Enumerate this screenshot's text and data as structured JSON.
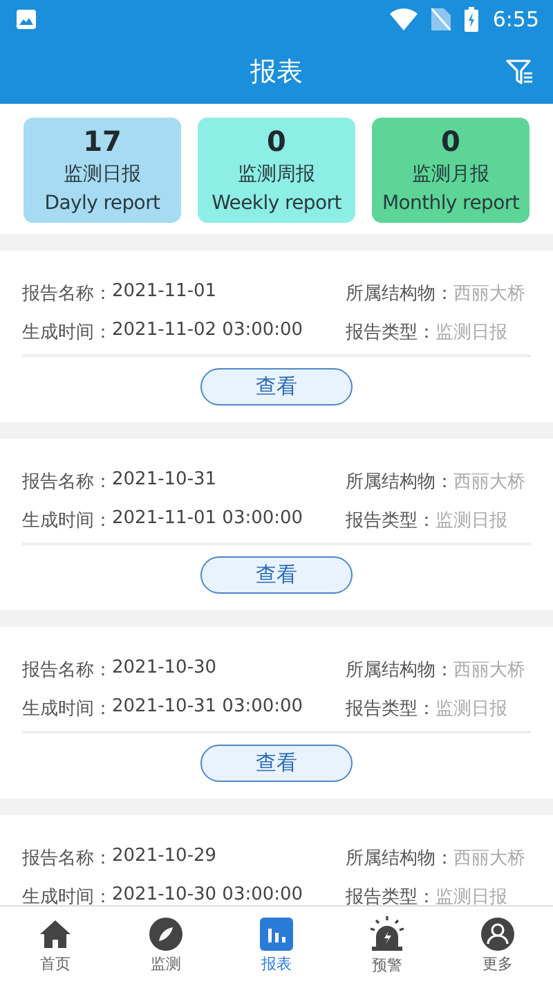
{
  "status_bar": {
    "time": "6:55"
  },
  "header": {
    "title": "报表"
  },
  "summary": [
    {
      "count": "17",
      "label": "监测日报",
      "sublabel": "Dayly report",
      "color": "#a6dbf1"
    },
    {
      "count": "0",
      "label": "监测周报",
      "sublabel": "Weekly report",
      "color": "#8deee5"
    },
    {
      "count": "0",
      "label": "监测月报",
      "sublabel": "Monthly report",
      "color": "#5cd596"
    }
  ],
  "reports": [
    {
      "name_label": "报告名称：",
      "name": "2021-11-01",
      "structure_label": "所属结构物：",
      "structure": "西丽大桥",
      "time_label": "生成时间：",
      "time": "2021-11-02 03:00:00",
      "type_label": "报告类型：",
      "type": "监测日报",
      "button": "查看"
    },
    {
      "name_label": "报告名称：",
      "name": "2021-10-31",
      "structure_label": "所属结构物：",
      "structure": "西丽大桥",
      "time_label": "生成时间：",
      "time": "2021-11-01 03:00:00",
      "type_label": "报告类型：",
      "type": "监测日报",
      "button": "查看"
    },
    {
      "name_label": "报告名称：",
      "name": "2021-10-30",
      "structure_label": "所属结构物：",
      "structure": "西丽大桥",
      "time_label": "生成时间：",
      "time": "2021-10-31 03:00:00",
      "type_label": "报告类型：",
      "type": "监测日报",
      "button": "查看"
    },
    {
      "name_label": "报告名称：",
      "name": "2021-10-29",
      "structure_label": "所属结构物：",
      "structure": "西丽大桥",
      "time_label": "生成时间：",
      "time": "2021-10-30 03:00:00",
      "type_label": "报告类型：",
      "type": "监测日报"
    }
  ],
  "bottom_nav": [
    {
      "label": "首页",
      "kind": "home",
      "selected": false
    },
    {
      "label": "监测",
      "kind": "compass",
      "selected": false
    },
    {
      "label": "报表",
      "kind": "chart",
      "selected": true
    },
    {
      "label": "预警",
      "kind": "alarm",
      "selected": false
    },
    {
      "label": "更多",
      "kind": "user",
      "selected": false
    }
  ]
}
